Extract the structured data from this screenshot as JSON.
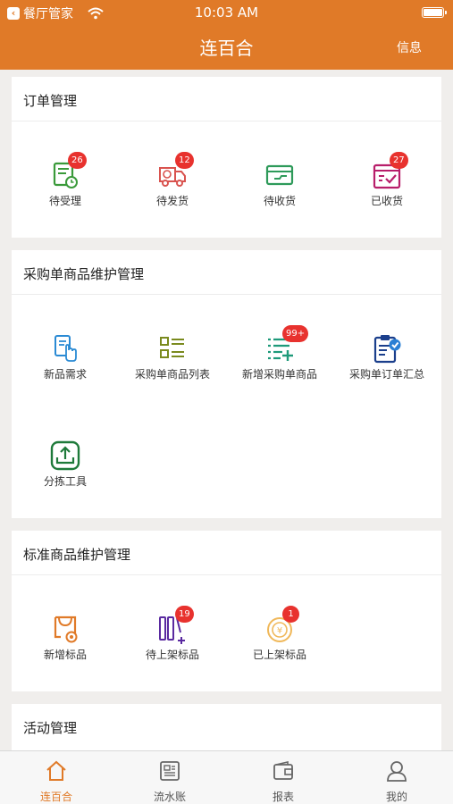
{
  "status_bar": {
    "carrier": "餐厅管家",
    "time": "10:03 AM"
  },
  "nav": {
    "title": "连百合",
    "right": "信息"
  },
  "sections": [
    {
      "title": "订单管理",
      "items": [
        {
          "label": "待受理",
          "icon": "clock-list-icon",
          "badge": "26"
        },
        {
          "label": "待发货",
          "icon": "delivery-truck-icon",
          "badge": "12"
        },
        {
          "label": "待收货",
          "icon": "receive-box-icon",
          "badge": ""
        },
        {
          "label": "已收货",
          "icon": "checked-calendar-icon",
          "badge": "27"
        }
      ]
    },
    {
      "title": "采购单商品维护管理",
      "items": [
        {
          "label": "新品需求",
          "icon": "hand-document-icon",
          "badge": ""
        },
        {
          "label": "采购单商品列表",
          "icon": "checklist-icon",
          "badge": ""
        },
        {
          "label": "新增采购单商品",
          "icon": "list-add-icon",
          "badge": "99+"
        },
        {
          "label": "采购单订单汇总",
          "icon": "clipboard-check-icon",
          "badge": ""
        },
        {
          "label": "分拣工具",
          "icon": "sorting-tray-icon",
          "badge": ""
        }
      ]
    },
    {
      "title": "标准商品维护管理",
      "items": [
        {
          "label": "新增标品",
          "icon": "new-product-icon",
          "badge": ""
        },
        {
          "label": "待上架标品",
          "icon": "pending-shelf-icon",
          "badge": "19"
        },
        {
          "label": "已上架标品",
          "icon": "shelved-coin-icon",
          "badge": "1"
        }
      ]
    },
    {
      "title": "活动管理",
      "items": []
    }
  ],
  "tabbar": [
    {
      "label": "连百合",
      "icon": "home-icon",
      "active": true
    },
    {
      "label": "流水账",
      "icon": "ledger-icon",
      "active": false
    },
    {
      "label": "报表",
      "icon": "wallet-icon",
      "active": false
    },
    {
      "label": "我的",
      "icon": "profile-icon",
      "active": false
    }
  ],
  "colors": {
    "brand": "#e07a28",
    "badge": "#e8322e",
    "background": "#f0eeec"
  }
}
